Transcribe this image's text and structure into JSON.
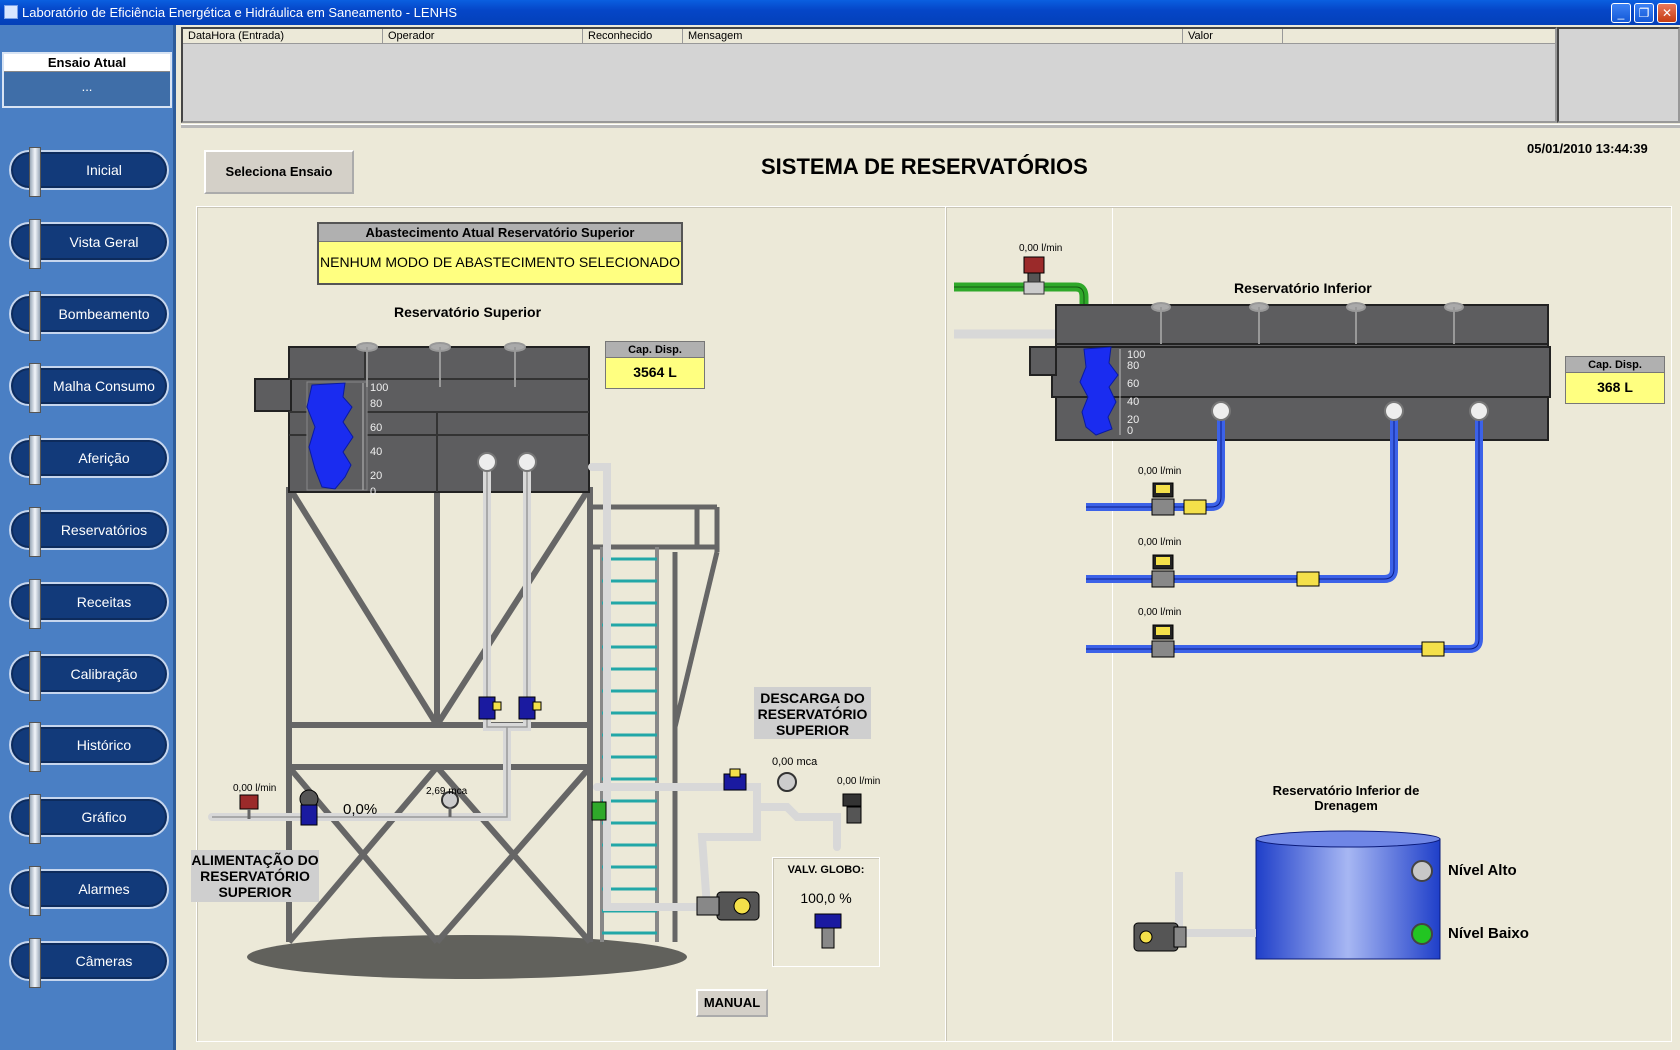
{
  "window": {
    "title": "Laboratório de Eficiência Energética e Hidráulica em Saneamento - LENHS",
    "min_glyph": "_",
    "max_glyph": "❐",
    "close_glyph": "✕"
  },
  "sidebar": {
    "ensaio_header": "Ensaio Atual",
    "ensaio_value": "...",
    "items": [
      {
        "label": "Inicial"
      },
      {
        "label": "Vista Geral"
      },
      {
        "label": "Bombeamento"
      },
      {
        "label": "Malha Consumo"
      },
      {
        "label": "Aferição"
      },
      {
        "label": "Reservatórios"
      },
      {
        "label": "Receitas"
      },
      {
        "label": "Calibração"
      },
      {
        "label": "Histórico"
      },
      {
        "label": "Gráfico"
      },
      {
        "label": "Alarmes"
      },
      {
        "label": "Câmeras"
      }
    ]
  },
  "alarm_table": {
    "columns": [
      "DataHora (Entrada)",
      "Operador",
      "Reconhecido",
      "Mensagem",
      "Valor"
    ]
  },
  "main": {
    "select_button": "Seleciona Ensaio",
    "title": "SISTEMA DE RESERVATÓRIOS",
    "datetime": "05/01/2010 13:44:39"
  },
  "left_panel": {
    "supply_header": "Abastecimento Atual Reservatório Superior",
    "supply_value": "NENHUM MODO DE ABASTECIMENTO SELECIONADO",
    "reservoir_title": "Reservatório Superior",
    "cap_label": "Cap. Disp.",
    "cap_value": "3564 L",
    "level_scale": [
      "100",
      "80",
      "60",
      "40",
      "20",
      "0"
    ],
    "flow_inlet": "0,00 l/min",
    "valve_pct": "0,0%",
    "pressure_inlet": "2,69 mca",
    "inlet_label": "ALIMENTAÇÃO DO RESERVATÓRIO SUPERIOR",
    "discharge_label": "DESCARGA DO RESERVATÓRIO SUPERIOR",
    "pressure_discharge": "0,00 mca",
    "flow_discharge": "0,00 l/min",
    "globe_valve_label": "VALV. GLOBO:",
    "globe_valve_value": "100,0 %",
    "manual_button": "MANUAL"
  },
  "right_panel": {
    "reservoir_title": "Reservatório Inferior",
    "flow_top": "0,00 l/min",
    "cap_label": "Cap. Disp.",
    "cap_value": "368 L",
    "level_scale": [
      "100",
      "80",
      "60",
      "40",
      "20",
      "0"
    ],
    "flow_1": "0,00 l/min",
    "flow_2": "0,00 l/min",
    "flow_3": "0,00 l/min",
    "drain_title": "Reservatório Inferior de Drenagem",
    "level_high": "Nível Alto",
    "level_low": "Nível Baixo"
  },
  "colors": {
    "water": "#1a2cf0",
    "pipe_blue": "#3c62e8",
    "pipe_green": "#2fa82a",
    "tank": "#5d5d5f",
    "indicator_high": "#c8c8c8",
    "indicator_low": "#22c522"
  }
}
